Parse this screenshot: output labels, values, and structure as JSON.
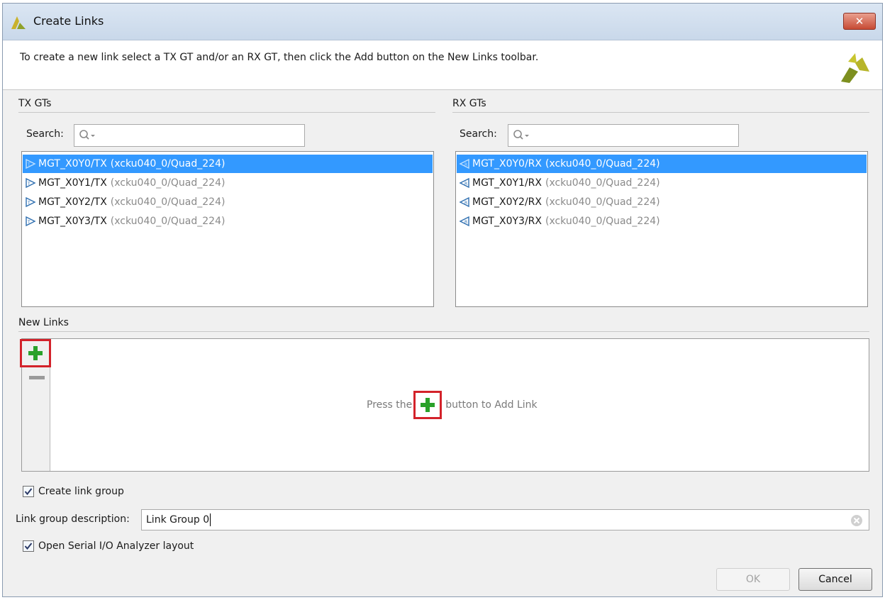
{
  "window": {
    "title": "Create Links",
    "close_label": "✕"
  },
  "banner": {
    "instruction": "To create a new link select a TX GT and/or an RX GT, then click the Add button on the New Links toolbar."
  },
  "tx": {
    "section_label": "TX GTs",
    "search_label": "Search:",
    "search_value": "",
    "items": [
      {
        "name": "MGT_X0Y0/TX",
        "path": "(xcku040_0/Quad_224)",
        "selected": true
      },
      {
        "name": "MGT_X0Y1/TX",
        "path": "(xcku040_0/Quad_224)",
        "selected": false
      },
      {
        "name": "MGT_X0Y2/TX",
        "path": "(xcku040_0/Quad_224)",
        "selected": false
      },
      {
        "name": "MGT_X0Y3/TX",
        "path": "(xcku040_0/Quad_224)",
        "selected": false
      }
    ]
  },
  "rx": {
    "section_label": "RX GTs",
    "search_label": "Search:",
    "search_value": "",
    "items": [
      {
        "name": "MGT_X0Y0/RX",
        "path": "(xcku040_0/Quad_224)",
        "selected": true
      },
      {
        "name": "MGT_X0Y1/RX",
        "path": "(xcku040_0/Quad_224)",
        "selected": false
      },
      {
        "name": "MGT_X0Y2/RX",
        "path": "(xcku040_0/Quad_224)",
        "selected": false
      },
      {
        "name": "MGT_X0Y3/RX",
        "path": "(xcku040_0/Quad_224)",
        "selected": false
      }
    ]
  },
  "new_links": {
    "section_label": "New Links",
    "hint_before": "Press the",
    "hint_after": "button to Add Link"
  },
  "options": {
    "create_link_group_label": "Create link group",
    "create_link_group_checked": true,
    "description_label": "Link group description:",
    "description_value": "Link Group 0",
    "open_analyzer_label": "Open Serial I/O Analyzer layout",
    "open_analyzer_checked": true
  },
  "buttons": {
    "ok_label": "OK",
    "ok_enabled": false,
    "cancel_label": "Cancel"
  },
  "colors": {
    "selection": "#3399ff",
    "add_green": "#2aa12a",
    "highlight_red": "#d3222a",
    "xilinx_olive": "#b7b52a"
  }
}
